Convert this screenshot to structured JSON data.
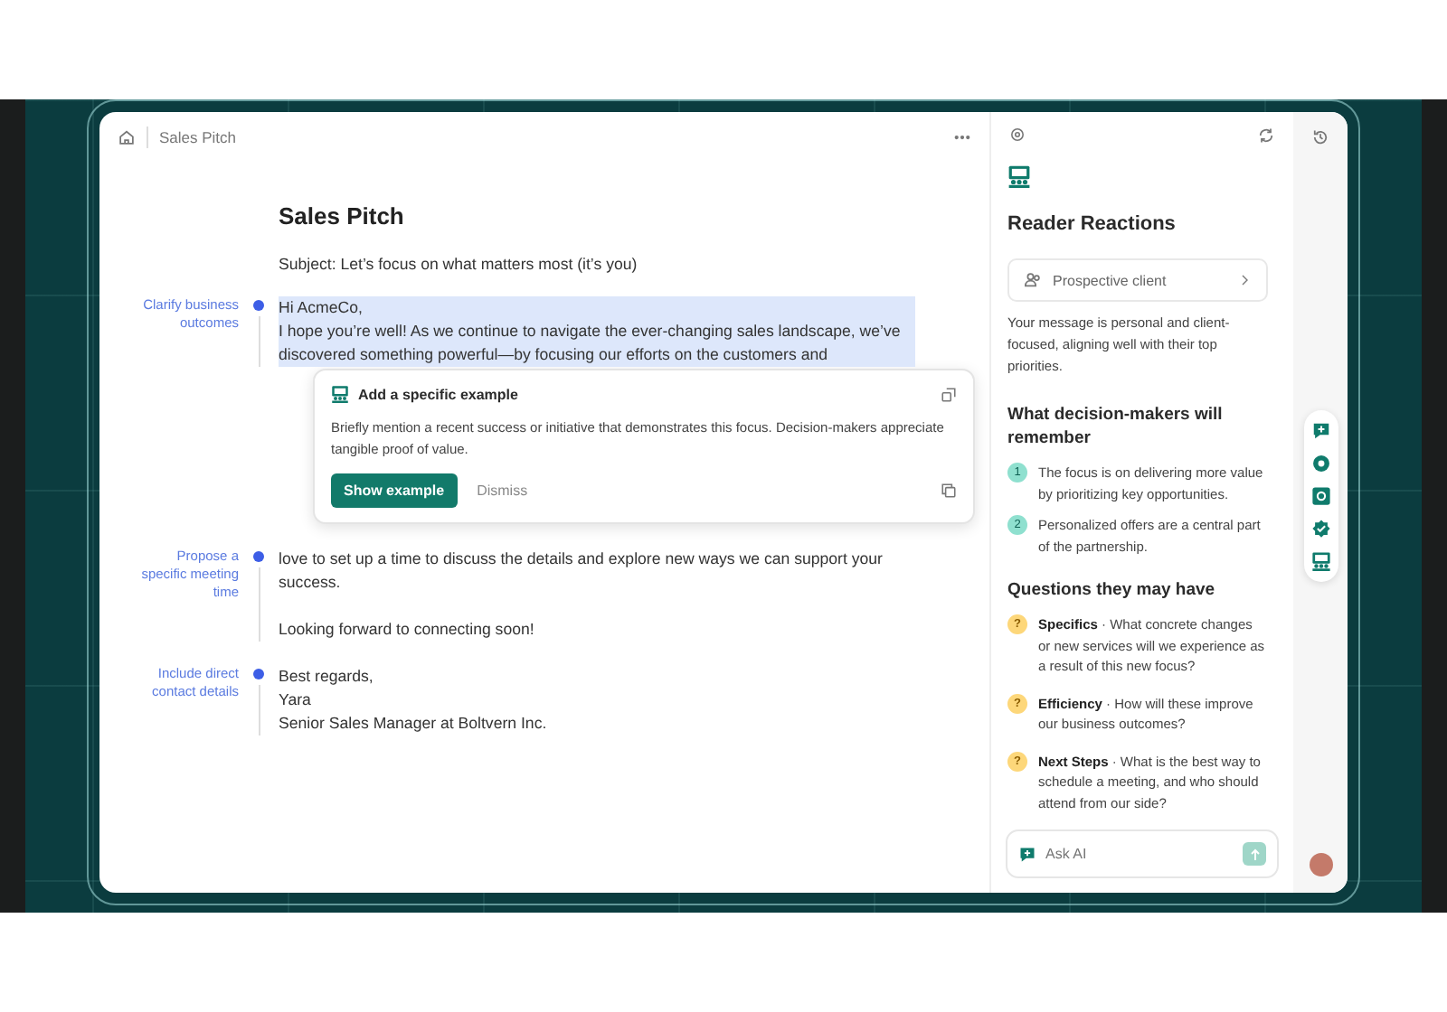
{
  "header": {
    "title": "Sales Pitch"
  },
  "document": {
    "title": "Sales Pitch",
    "subject": "Subject: Let’s focus on what matters most (it’s you)",
    "sections": [
      {
        "note": "Clarify business outcomes",
        "highlighted": true,
        "paragraphs": [
          "Hi AcmeCo,\nI hope you’re well! As we continue to navigate the ever-changing sales landscape, we’ve discovered something powerful—by focusing our efforts on the customers and"
        ]
      },
      {
        "note": "Propose a specific meeting time",
        "highlighted": false,
        "paragraphs": [
          "love to set up a time to discuss the details and explore new ways we can support your success.",
          "Looking forward to connecting soon!"
        ]
      },
      {
        "note": "Include direct contact details",
        "highlighted": false,
        "paragraphs": [
          "Best regards,\nYara\nSenior Sales Manager at Boltvern Inc."
        ]
      }
    ]
  },
  "suggestion": {
    "title": "Add a specific example",
    "body": "Briefly mention a recent success or initiative that demonstrates this focus. Decision-makers appreciate tangible proof of value.",
    "primary_button": "Show example",
    "secondary_button": "Dismiss"
  },
  "panel": {
    "title": "Reader Reactions",
    "persona": "Prospective client",
    "summary": "Your message is personal and client-focused, aligning well with their top priorities.",
    "remember": {
      "heading": "What decision-makers will remember",
      "items": [
        {
          "number": "1",
          "text": "The focus is on delivering more value by prioritizing key opportunities."
        },
        {
          "number": "2",
          "text": "Personalized offers are a central part of the partnership."
        }
      ]
    },
    "questions": {
      "heading": "Questions they may have",
      "items": [
        {
          "marker": "?",
          "text": "**Specifics** · What concrete changes or new services will we experience as a result of this new focus?"
        },
        {
          "marker": "?",
          "text": "**Efficiency** · How will these improve our business outcomes?"
        },
        {
          "marker": "?",
          "text": "**Next Steps** · What is the best way to schedule a meeting, and who should attend from our side?"
        }
      ]
    },
    "ask": {
      "placeholder": "Ask AI"
    }
  }
}
